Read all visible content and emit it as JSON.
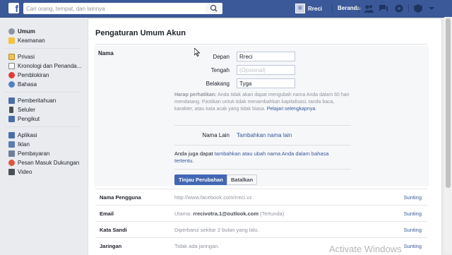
{
  "topbar": {
    "logo": "f",
    "search_placeholder": "Cari orang, tempat, dan lainnya",
    "user_name": "Rreci",
    "home_label": "Beranda",
    "brand_color": "#3b5998"
  },
  "sidebar": {
    "group1": [
      {
        "label": "Umum",
        "icon": "gear-icon",
        "active": true
      },
      {
        "label": "Keamanan",
        "icon": "shield-icon"
      }
    ],
    "group2": [
      {
        "label": "Privasi",
        "icon": "lock-icon"
      },
      {
        "label": "Kronologi dan Penanda...",
        "icon": "timeline-icon"
      },
      {
        "label": "Pemblokiran",
        "icon": "block-icon"
      },
      {
        "label": "Bahasa",
        "icon": "globe-icon"
      }
    ],
    "group3": [
      {
        "label": "Pemberitahuan",
        "icon": "notification-icon"
      },
      {
        "label": "Seluler",
        "icon": "mobile-icon"
      },
      {
        "label": "Pengikut",
        "icon": "rss-icon"
      }
    ],
    "group4": [
      {
        "label": "Aplikasi",
        "icon": "apps-icon"
      },
      {
        "label": "Iklan",
        "icon": "ads-icon"
      },
      {
        "label": "Pembayaran",
        "icon": "payment-icon"
      },
      {
        "label": "Pesan Masuk Dukungan",
        "icon": "support-icon"
      },
      {
        "label": "Video",
        "icon": "video-icon"
      }
    ]
  },
  "main": {
    "title": "Pengaturan Umum Akun",
    "name_section": {
      "label": "Nama",
      "first_label": "Depan",
      "first_value": "Rreci",
      "middle_label": "Tengah",
      "middle_placeholder": "(Opsional)",
      "last_label": "Belakang",
      "last_value": "Tyga",
      "note_heading": "Harap perhatikan:",
      "note_text": " Anda tidak akan dapat mengubah nama Anda dalam 60 hari mendatang. Pastikan untuk tidak menambahkan kapitalisasi, tanda baca, karakter, atau kata acak yang tidak biasa. ",
      "note_link": "Pelajari selengkapnya",
      "note_end": ".",
      "other_name_label": "Nama Lain",
      "other_name_link": "Tambahkan nama lain",
      "lang_prefix": "Anda juga dapat ",
      "lang_link": "tambahkan atau ubah nama Anda dalam bahasa tertentu",
      "lang_suffix": ".",
      "review_button": "Tinjau Perubahan",
      "cancel_button": "Batalkan"
    },
    "rows": [
      {
        "label": "Nama Pengguna",
        "value_prefix": "http://www.facebook.com/",
        "value_bold": "rreci.vz",
        "value_suffix": "",
        "edit": "Sunting"
      },
      {
        "label": "Email",
        "value_prefix": "Utama: ",
        "value_bold": "rrecivotra.1@outlook.com",
        "value_suffix": " (Tertunda)",
        "edit": "Sunting"
      },
      {
        "label": "Kata Sandi",
        "value_prefix": "Diperbarui sekitar 2 bulan yang lalu.",
        "value_bold": "",
        "value_suffix": "",
        "edit": "Sunting"
      },
      {
        "label": "Jaringan",
        "value_prefix": "Tidak ada jaringan.",
        "value_bold": "",
        "value_suffix": "",
        "edit": "Sunting"
      }
    ]
  },
  "watermark": "Activate Windows"
}
